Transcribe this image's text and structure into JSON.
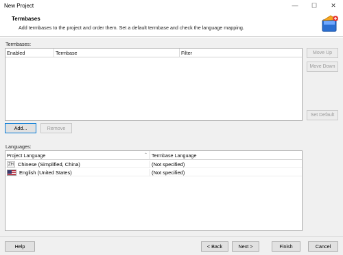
{
  "window": {
    "title": "New Project"
  },
  "window_controls": {
    "minimize_icon": "minimize-icon",
    "maximize_icon": "maximize-icon",
    "close_icon": "close-icon"
  },
  "header": {
    "title": "Termbases",
    "description": "Add termbases to the project and order them. Set a default termbase and check the language mapping.",
    "logo_icon": "wizard-logo-icon"
  },
  "termbases": {
    "label": "Termbases:",
    "columns": [
      "Enabled",
      "Termbase",
      "Filter"
    ],
    "rows": [],
    "move_up_label": "Move Up",
    "move_down_label": "Move Down",
    "set_default_label": "Set Default",
    "add_label": "Add...",
    "remove_label": "Remove"
  },
  "languages": {
    "label": "Languages:",
    "columns": [
      "Project Language",
      "Termbase Language"
    ],
    "rows": [
      {
        "code": "ZH",
        "language": "Chinese (Simplified, China)",
        "termbase_language": "(Not specified)"
      },
      {
        "flag": "us-flag-icon",
        "language": "English (United States)",
        "termbase_language": "(Not specified)"
      }
    ]
  },
  "footer": {
    "help_label": "Help",
    "back_label": "< Back",
    "next_label": "Next >",
    "finish_label": "Finish",
    "cancel_label": "Cancel"
  }
}
